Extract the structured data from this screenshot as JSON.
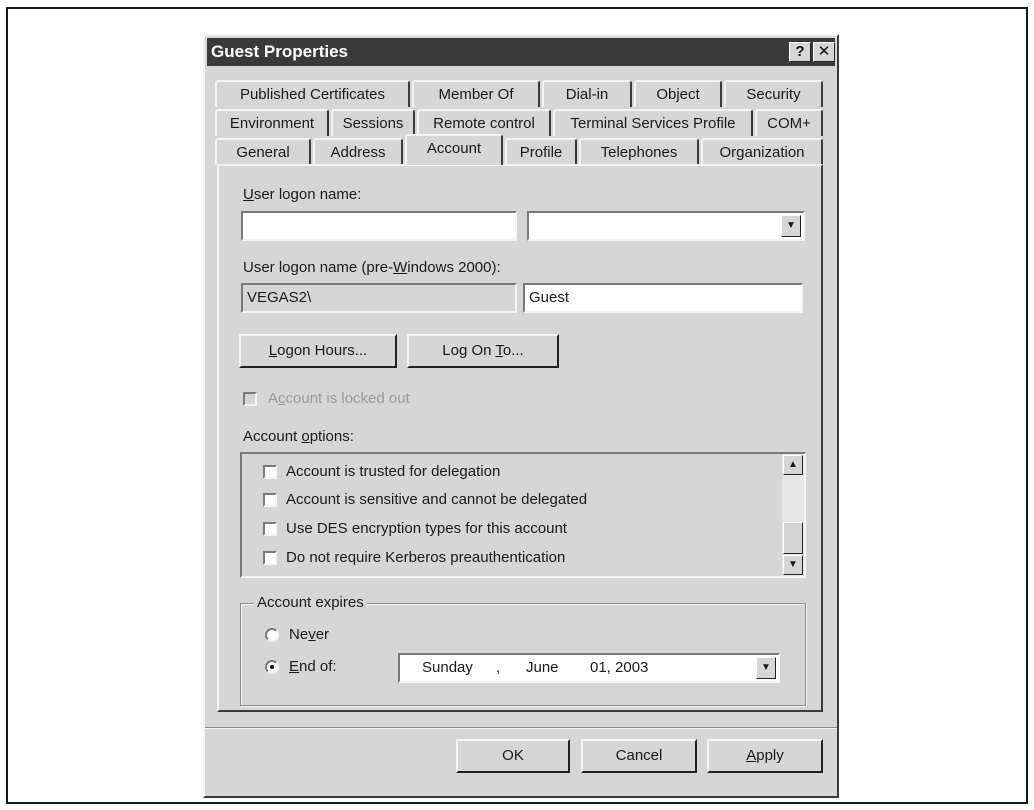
{
  "dialog": {
    "title": "Guest Properties",
    "help_button": "?",
    "close_button": "✕"
  },
  "tabs": {
    "row1": [
      "Published Certificates",
      "Member Of",
      "Dial-in",
      "Object",
      "Security"
    ],
    "row2": [
      "Environment",
      "Sessions",
      "Remote control",
      "Terminal Services Profile",
      "COM+"
    ],
    "row3": [
      "General",
      "Address",
      "Account",
      "Profile",
      "Telephones",
      "Organization"
    ],
    "selected": "Account"
  },
  "account": {
    "logon_name_label": "User logon name:",
    "logon_name_value": "",
    "domain_suffix_value": "",
    "pre2000_label": "User logon name (pre-Windows 2000):",
    "pre2000_domain": "VEGAS2\\",
    "pre2000_user": "Guest",
    "logon_hours_button": "Logon Hours...",
    "log_on_to_button": "Log On To...",
    "locked_out_label": "Account is locked out",
    "locked_out_checked": false,
    "options_label": "Account options:",
    "options": [
      {
        "label": "Account is trusted for delegation",
        "checked": false
      },
      {
        "label": "Account is sensitive and cannot be delegated",
        "checked": false
      },
      {
        "label": "Use DES encryption types for this account",
        "checked": false
      },
      {
        "label": "Do not require Kerberos preauthentication",
        "checked": false
      }
    ],
    "expires": {
      "group_label": "Account expires",
      "never_label": "Never",
      "end_of_label": "End of:",
      "selected": "End of:",
      "date_day": "Sunday",
      "date_sep": ",",
      "date_month": "June",
      "date_rest": "01, 2003"
    }
  },
  "footer": {
    "ok": "OK",
    "cancel": "Cancel",
    "apply": "Apply"
  },
  "icons": {
    "dropdown": "chevron-down-icon",
    "scroll_up": "arrow-up-icon",
    "scroll_down": "arrow-down-icon",
    "help": "question-icon",
    "close": "close-icon"
  }
}
